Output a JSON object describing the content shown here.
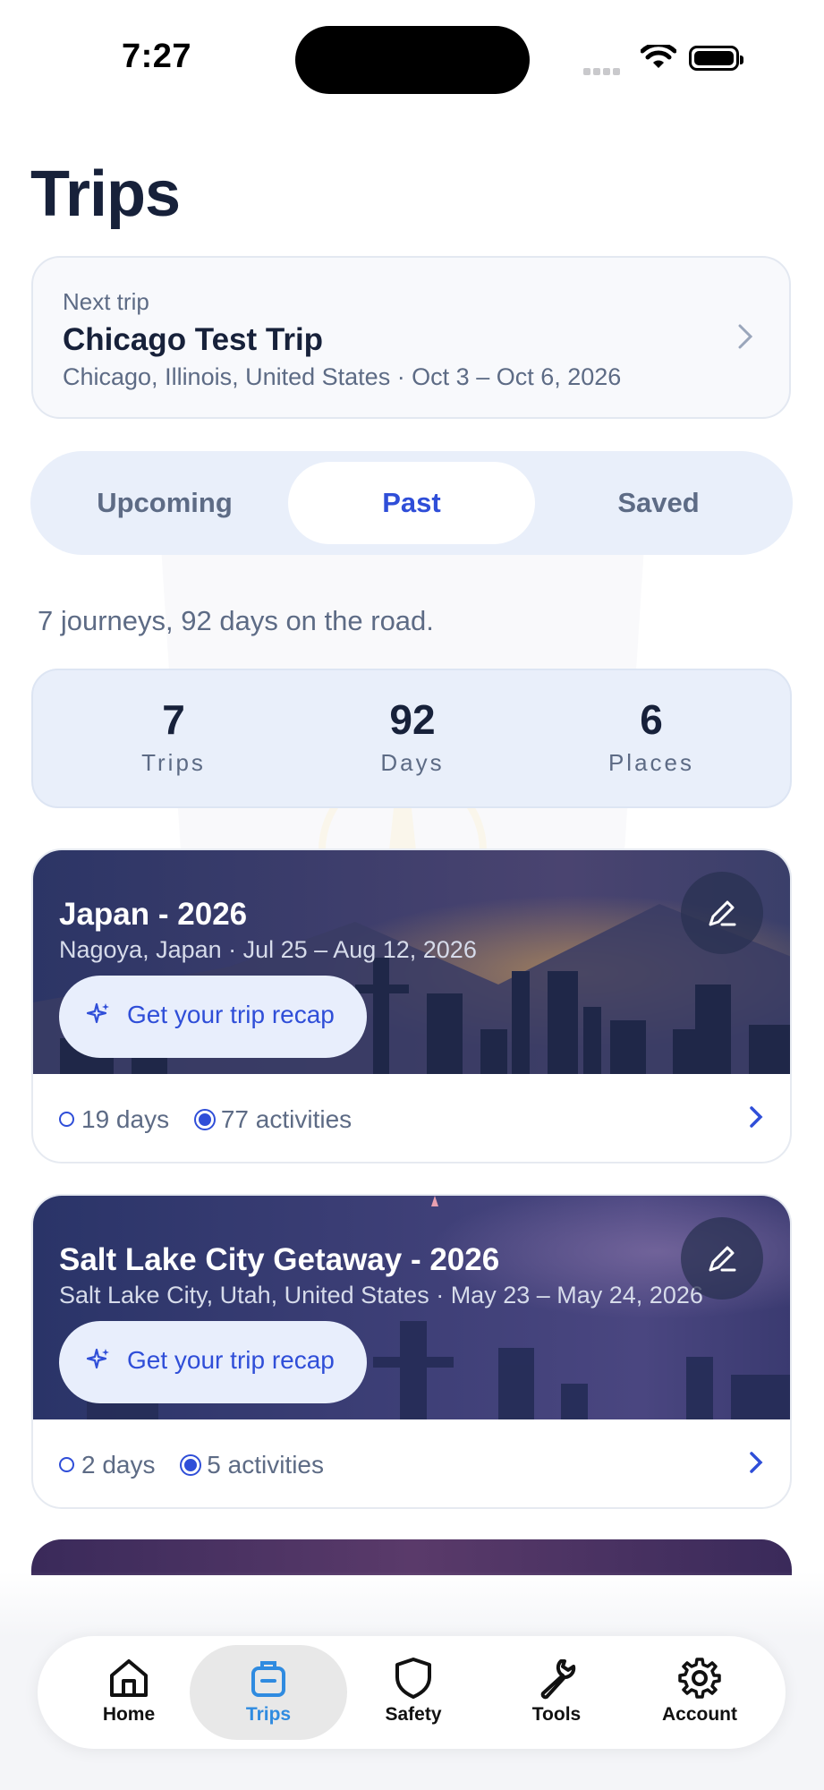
{
  "status_bar": {
    "time": "7:27"
  },
  "page": {
    "title": "Trips"
  },
  "next_trip": {
    "label": "Next trip",
    "title": "Chicago Test Trip",
    "subtitle": "Chicago, Illinois, United States · Oct 3 – Oct 6, 2026"
  },
  "tabs": [
    {
      "label": "Upcoming",
      "active": false
    },
    {
      "label": "Past",
      "active": true
    },
    {
      "label": "Saved",
      "active": false
    }
  ],
  "summary": "7 journeys, 92 days on the road.",
  "stats": [
    {
      "value": "7",
      "label": "Trips"
    },
    {
      "value": "92",
      "label": "Days"
    },
    {
      "value": "6",
      "label": "Places"
    }
  ],
  "trips": [
    {
      "title": "Japan - 2026",
      "subtitle": "Nagoya, Japan · Jul 25 – Aug 12, 2026",
      "recap_label": "Get your trip recap",
      "days": "19 days",
      "activities": "77 activities"
    },
    {
      "title": "Salt Lake City Getaway - 2026",
      "subtitle": "Salt Lake City, Utah, United States · May 23 – May 24, 2026",
      "recap_label": "Get your trip recap",
      "days": "2 days",
      "activities": "5 activities"
    }
  ],
  "tab_bar": [
    {
      "label": "Home",
      "icon": "home-icon",
      "active": false
    },
    {
      "label": "Trips",
      "icon": "suitcase-icon",
      "active": true
    },
    {
      "label": "Safety",
      "icon": "shield-icon",
      "active": false
    },
    {
      "label": "Tools",
      "icon": "wrench-icon",
      "active": false
    },
    {
      "label": "Account",
      "icon": "gear-icon",
      "active": false
    }
  ],
  "colors": {
    "accent": "#2f4ed8",
    "text_primary": "#17213a",
    "text_secondary": "#5d6b85",
    "segment_bg": "#e9effa",
    "active_tab": "#2f8be0"
  }
}
